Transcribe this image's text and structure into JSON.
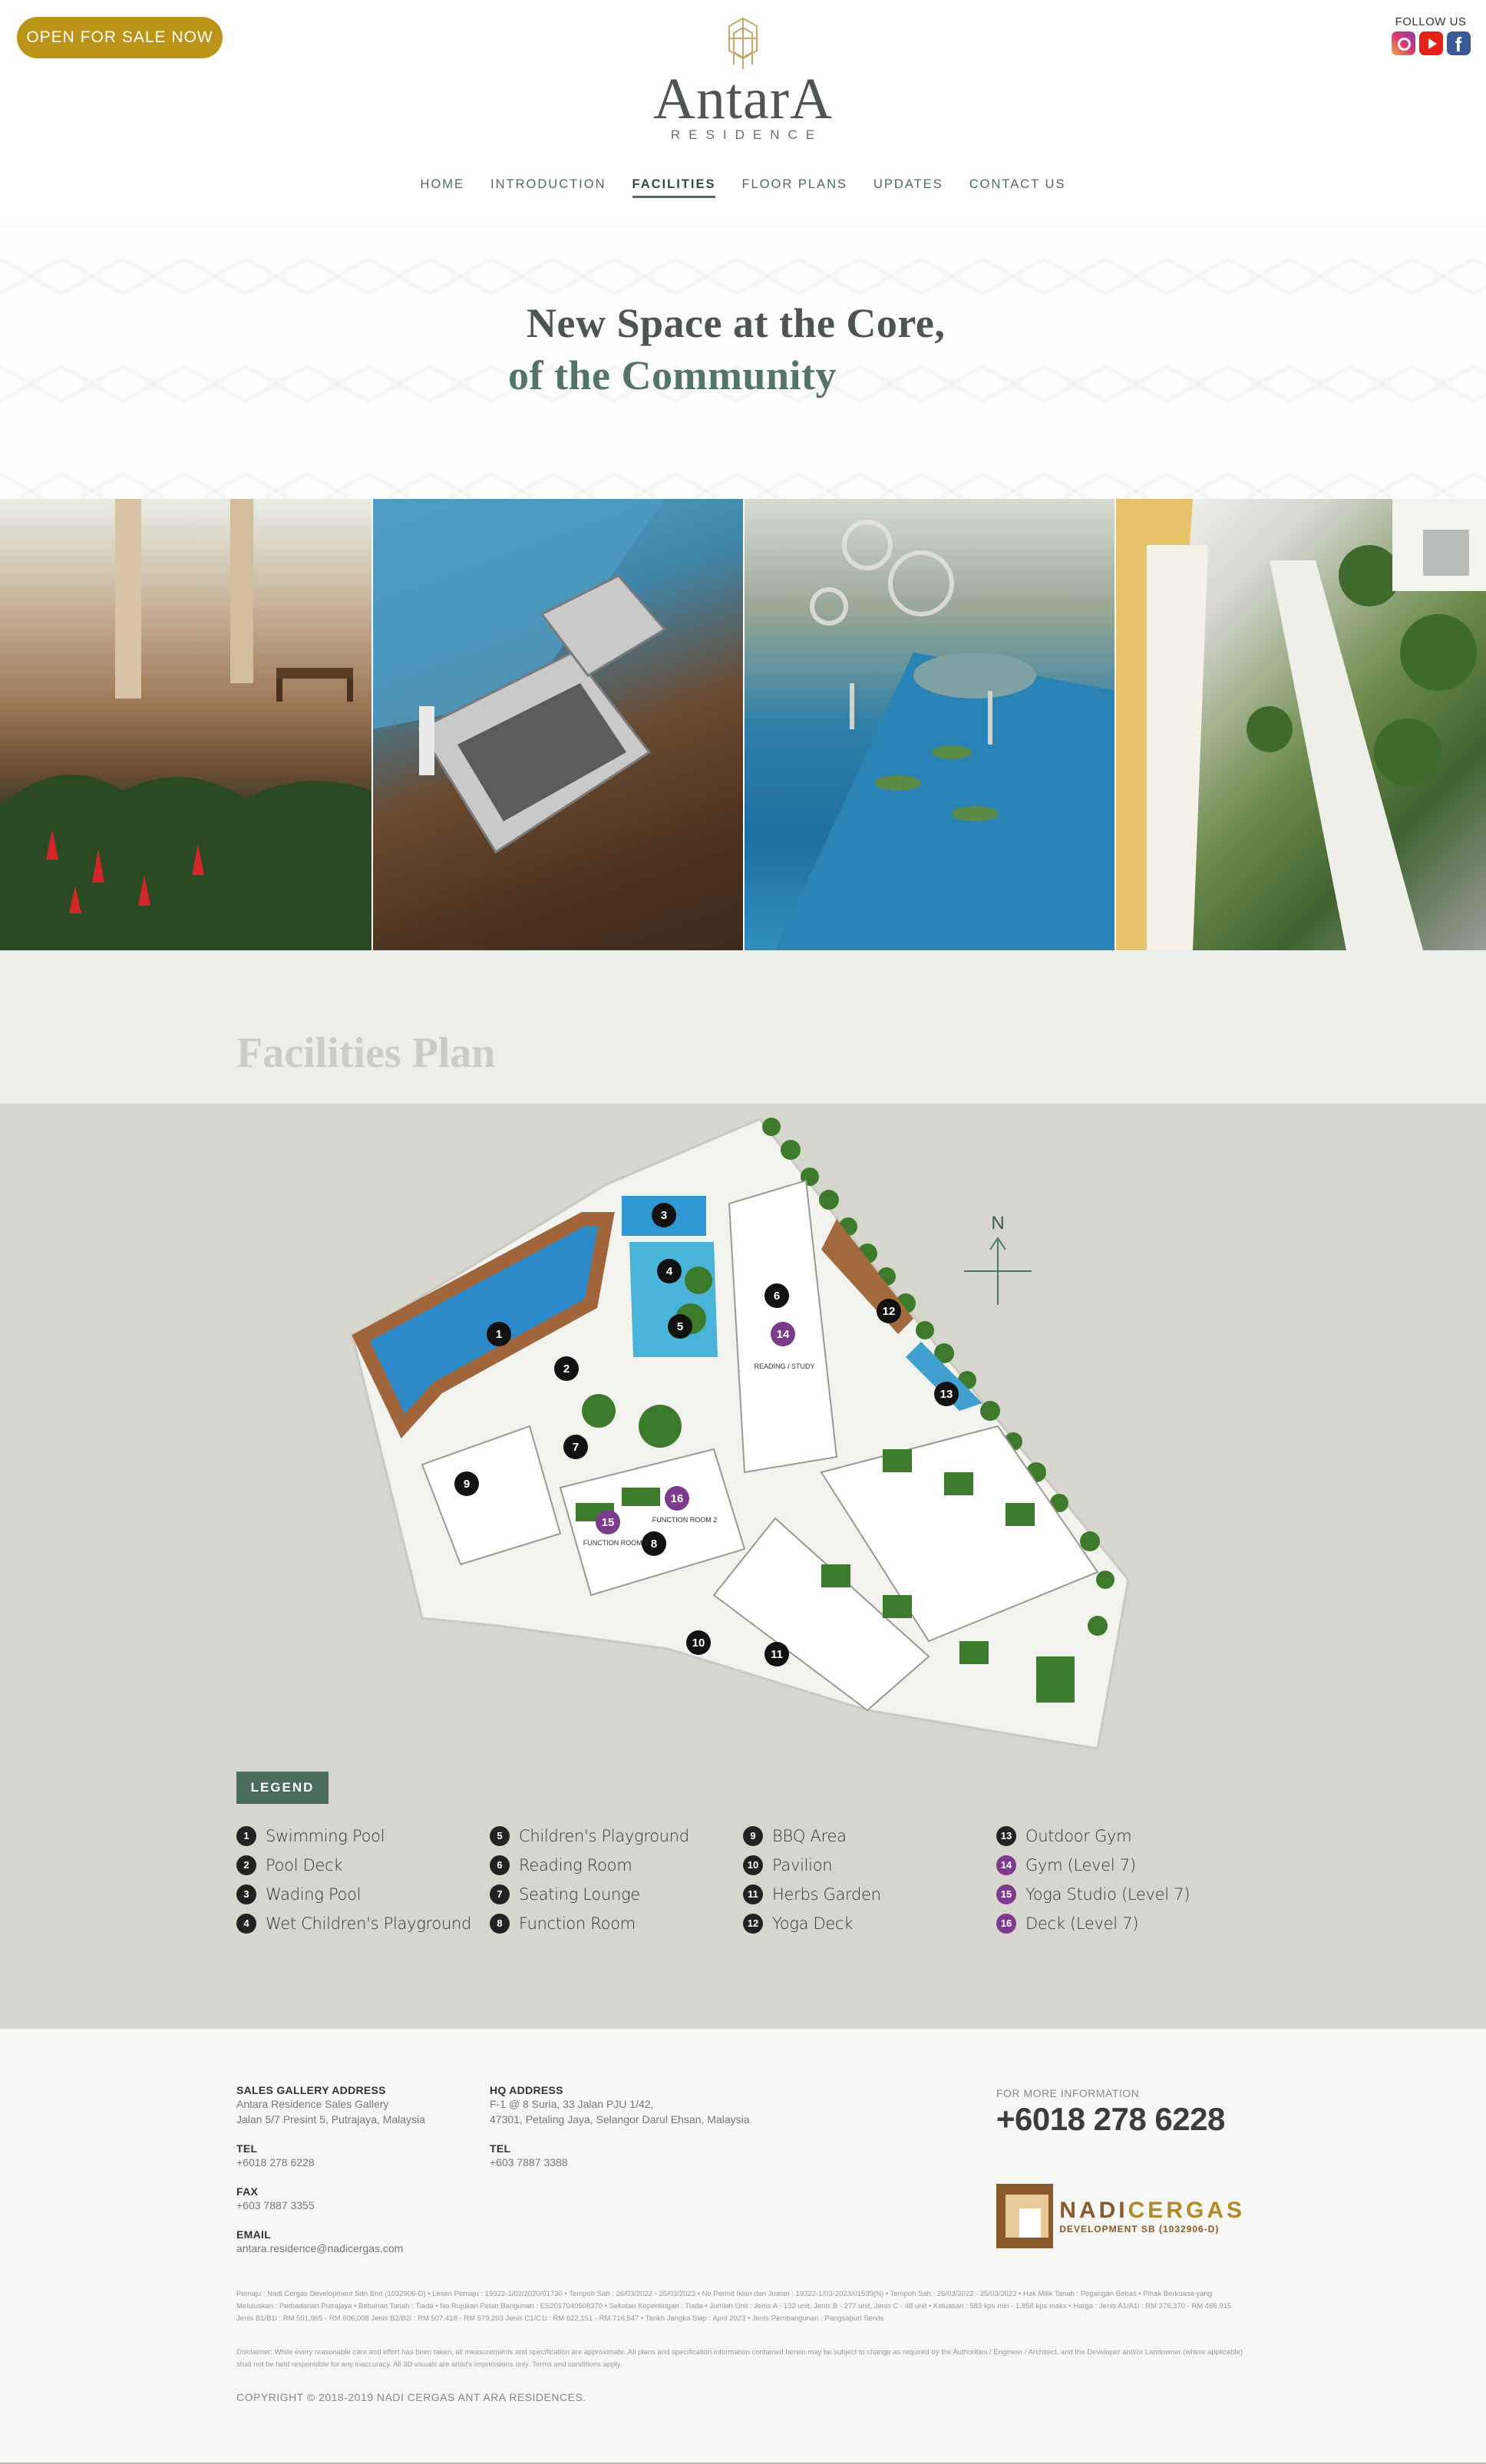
{
  "header": {
    "cta_label": "OPEN FOR SALE NOW",
    "logo_word": "AntarA",
    "logo_sub": "RESIDENCE",
    "follow_label": "FOLLOW US",
    "social": [
      "instagram-icon",
      "youtube-icon",
      "facebook-icon"
    ],
    "accent_color": "#bb9317"
  },
  "nav": {
    "items": [
      {
        "label": "HOME"
      },
      {
        "label": "INTRODUCTION"
      },
      {
        "label": "FACILITIES"
      },
      {
        "label": "FLOOR PLANS"
      },
      {
        "label": "UPDATES"
      },
      {
        "label": "CONTACT US"
      }
    ],
    "active": "FACILITIES"
  },
  "hero": {
    "line1": "New Space at the Core,",
    "line2": "of the Community"
  },
  "plan": {
    "title": "Facilities Plan",
    "north_label": "N",
    "legend_label": "LEGEND",
    "legend": [
      {
        "num": "1",
        "label": "Swimming Pool",
        "purple": false
      },
      {
        "num": "5",
        "label": "Children's Playground",
        "purple": false
      },
      {
        "num": "9",
        "label": "BBQ Area",
        "purple": false
      },
      {
        "num": "13",
        "label": "Outdoor Gym",
        "purple": false
      },
      {
        "num": "2",
        "label": "Pool Deck",
        "purple": false
      },
      {
        "num": "6",
        "label": "Reading Room",
        "purple": false
      },
      {
        "num": "10",
        "label": "Pavilion",
        "purple": false
      },
      {
        "num": "14",
        "label": "Gym (Level 7)",
        "purple": true
      },
      {
        "num": "3",
        "label": "Wading Pool",
        "purple": false
      },
      {
        "num": "7",
        "label": "Seating Lounge",
        "purple": false
      },
      {
        "num": "11",
        "label": "Herbs Garden",
        "purple": false
      },
      {
        "num": "15",
        "label": "Yoga Studio (Level 7)",
        "purple": true
      },
      {
        "num": "4",
        "label": "Wet Children's Playground",
        "purple": false
      },
      {
        "num": "8",
        "label": "Function Room",
        "purple": false
      },
      {
        "num": "12",
        "label": "Yoga Deck",
        "purple": false
      },
      {
        "num": "16",
        "label": "Deck (Level 7)",
        "purple": true
      }
    ],
    "map_labels": {
      "reading": "READING / STUDY",
      "func1": "FUNCTION ROOM 1",
      "func2": "FUNCTION ROOM 2"
    }
  },
  "footer": {
    "sales_heading": "SALES GALLERY ADDRESS",
    "sales_line1": "Antara Residence Sales Gallery",
    "sales_line2": "Jalan 5/7 Presint 5, Putrajaya, Malaysia",
    "tel_heading": "TEL",
    "sales_tel": "+6018 278 6228",
    "fax_heading": "FAX",
    "sales_fax": "+603 7887 3355",
    "email_heading": "EMAIL",
    "email": "antara.residence@nadicergas.com",
    "hq_heading": "HQ ADDRESS",
    "hq_line1": "F-1 @ 8 Suria, 33 Jalan PJU 1/42,",
    "hq_line2": "47301, Petaling Jaya, Selangor Darul Ehsan, Malaysia",
    "hq_tel": "+603 7887 3388",
    "more_label": "FOR MORE INFORMATION",
    "more_phone": "+6018 278 6228",
    "dev_name_a": "NADI",
    "dev_name_b": "CERGAS",
    "dev_sub": "DEVELOPMENT SB (1032906-D)",
    "fine_print": "Pemaju : Nadi Cergas Development Sdn Bhd (1032906-D) • Lesen Pemaju : 19322-1/02/2020/01730 • Tempoh Sah : 26/03/2022 - 25/03/2023 • No Permit Iklan dan Jualan : 19322-1/03-2023/01539(N) • Tempoh Sah : 26/03/2022 - 25/03/2023 • Hak Milik Tanah : Pegangan Bebas • Pihak Berkuasa yang Meluluskan : Perbadanan Putrajaya • Bebanan Tanah : Tiada • No Rujukan Pelan Bangunan : ES2017040508370 • Sekatan Kepentingan : Tiada • Jumlah Unit : Jenis A - 132 unit, Jenis B - 277 unit, Jenis C - 48 unit • Keluasan : 583 kps min - 1,858 kps maks • Harga : Jenis A1/A1i : RM 376,370 - RM 466,915 Jenis B1/B1i : RM 501,965 - RM 606,008 Jenis B2/B2i : RM 507,418 - RM 579,293 Jenis C1/C1i : RM 622,151 - RM 716,547 • Tarikh Jangka Siap : April 2023 • Jenis Pembangunan : Pangsapuri Servis",
    "disclaimer": "Disclaimer: While every reasonable care and effort has been taken, all measurements and specification are approximate. All plans and specification information contained herein may be subject to change as required by the Authorities / Engineer / Architect, and the Developer and/or Landowner (where applicable) shall not be held responsible for any inaccuracy. All 3D visuals are artist's impressions only. Terms and conditions apply.",
    "copyright": "COPYRIGHT © 2018-2019 NADI CERGAS ANT ARA RESIDENCES."
  }
}
